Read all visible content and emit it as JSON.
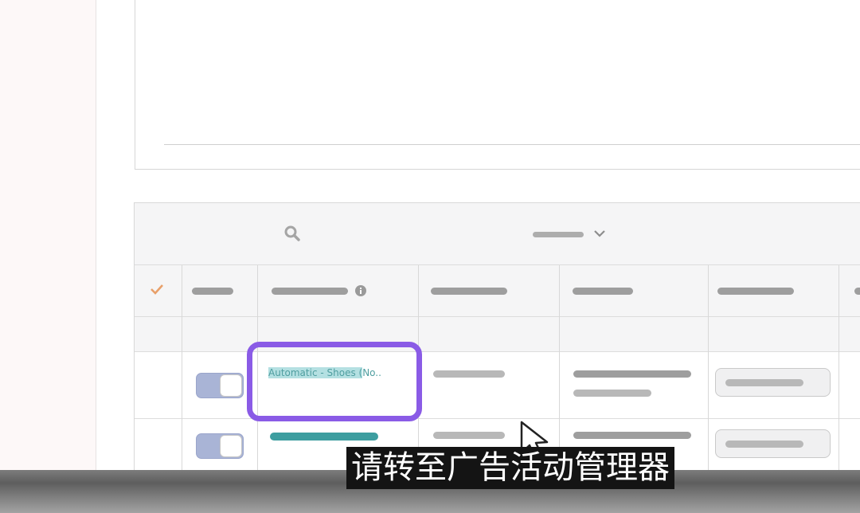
{
  "table": {
    "rows": [
      {
        "campaign_name_highlighted": "Automatic - Shoes (",
        "campaign_name_rest": "No.."
      }
    ]
  },
  "subtitle": {
    "text": "请转至广告活动管理器"
  },
  "colors": {
    "highlight_border": "#8a5be6",
    "toggle_on": "#a9b4d6",
    "campaign_link": "#4f9ea0",
    "checkmark": "#e8a06a"
  },
  "icons": {
    "search": "search-icon",
    "dropdown": "chevron-down-icon",
    "info": "info-icon",
    "select_all": "check-icon"
  }
}
